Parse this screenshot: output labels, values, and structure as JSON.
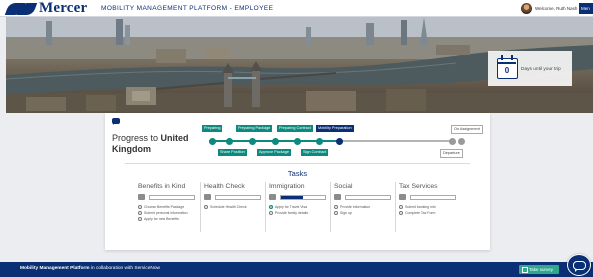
{
  "header": {
    "logo_text": "Mercer",
    "platform_title": "MOBILITY MANAGEMENT PLATFORM - EMPLOYEE",
    "welcome": "Welcome, Ruth Nash",
    "menu_label": "Men"
  },
  "countdown": {
    "days": "0",
    "label": "Days until your trip"
  },
  "progress": {
    "title_prefix": "Progress to",
    "title_country_line1": "United",
    "title_country_line2": "Kingdom",
    "steps": [
      {
        "label": "Preparing",
        "state": "done"
      },
      {
        "label": "Share Position",
        "state": "done"
      },
      {
        "label": "Preparing Package",
        "state": "done"
      },
      {
        "label": "Approve Package",
        "state": "done"
      },
      {
        "label": "Preparing Contract",
        "state": "done"
      },
      {
        "label": "Sign Contract",
        "state": "done"
      },
      {
        "label": "Mobility Preparation",
        "state": "current"
      },
      {
        "label": "On Assignment",
        "state": "pending"
      },
      {
        "label": "Departure",
        "state": "pending"
      }
    ]
  },
  "tasks": {
    "title": "Tasks",
    "columns": [
      {
        "title": "Benefits in Kind",
        "icon": "thumbs-up-icon",
        "progress": 0,
        "items": [
          {
            "label": "Choose Benefits Package",
            "done": false
          },
          {
            "label": "Submit personal information",
            "done": false
          },
          {
            "label": "Apply for new Benefits",
            "done": false
          }
        ]
      },
      {
        "title": "Health Check",
        "icon": "medical-bag-icon",
        "progress": 0,
        "items": [
          {
            "label": "Schedule Health Check",
            "done": false
          }
        ]
      },
      {
        "title": "Immigration",
        "icon": "passport-icon",
        "progress": 0.5,
        "items": [
          {
            "label": "Apply for Travel Visa",
            "done": true
          },
          {
            "label": "Provide family details",
            "done": false
          }
        ]
      },
      {
        "title": "Social",
        "icon": "chat-icon",
        "progress": 0,
        "items": [
          {
            "label": "Provide information",
            "done": false
          },
          {
            "label": "Sign up",
            "done": false
          }
        ]
      },
      {
        "title": "Tax Services",
        "icon": "money-icon",
        "progress": 0,
        "items": [
          {
            "label": "Submit banking info",
            "done": false
          },
          {
            "label": "Complete Tax Form",
            "done": false
          }
        ]
      }
    ]
  },
  "footer": {
    "brand": "Mobility Management Platform",
    "suffix": "in collaboration with ServiceNow",
    "survey_label": "Take survey"
  },
  "colors": {
    "navy": "#0a2f74",
    "teal": "#0d8a7f",
    "survey_green": "#2fa88d"
  }
}
